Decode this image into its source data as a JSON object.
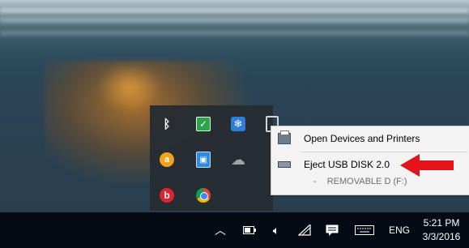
{
  "context_menu": {
    "open_devices_label": "Open Devices and Printers",
    "eject_label": "Eject USB DISK 2.0",
    "sub_item_dash": "-",
    "sub_item_label": "REMOVABLE D (F:)"
  },
  "taskbar": {
    "language": "ENG",
    "time": "5:21 PM",
    "date": "3/3/2016"
  },
  "colors": {
    "arrow": "#e3131b",
    "taskbar": "#050a14",
    "menu_bg": "#f3f3f3"
  }
}
